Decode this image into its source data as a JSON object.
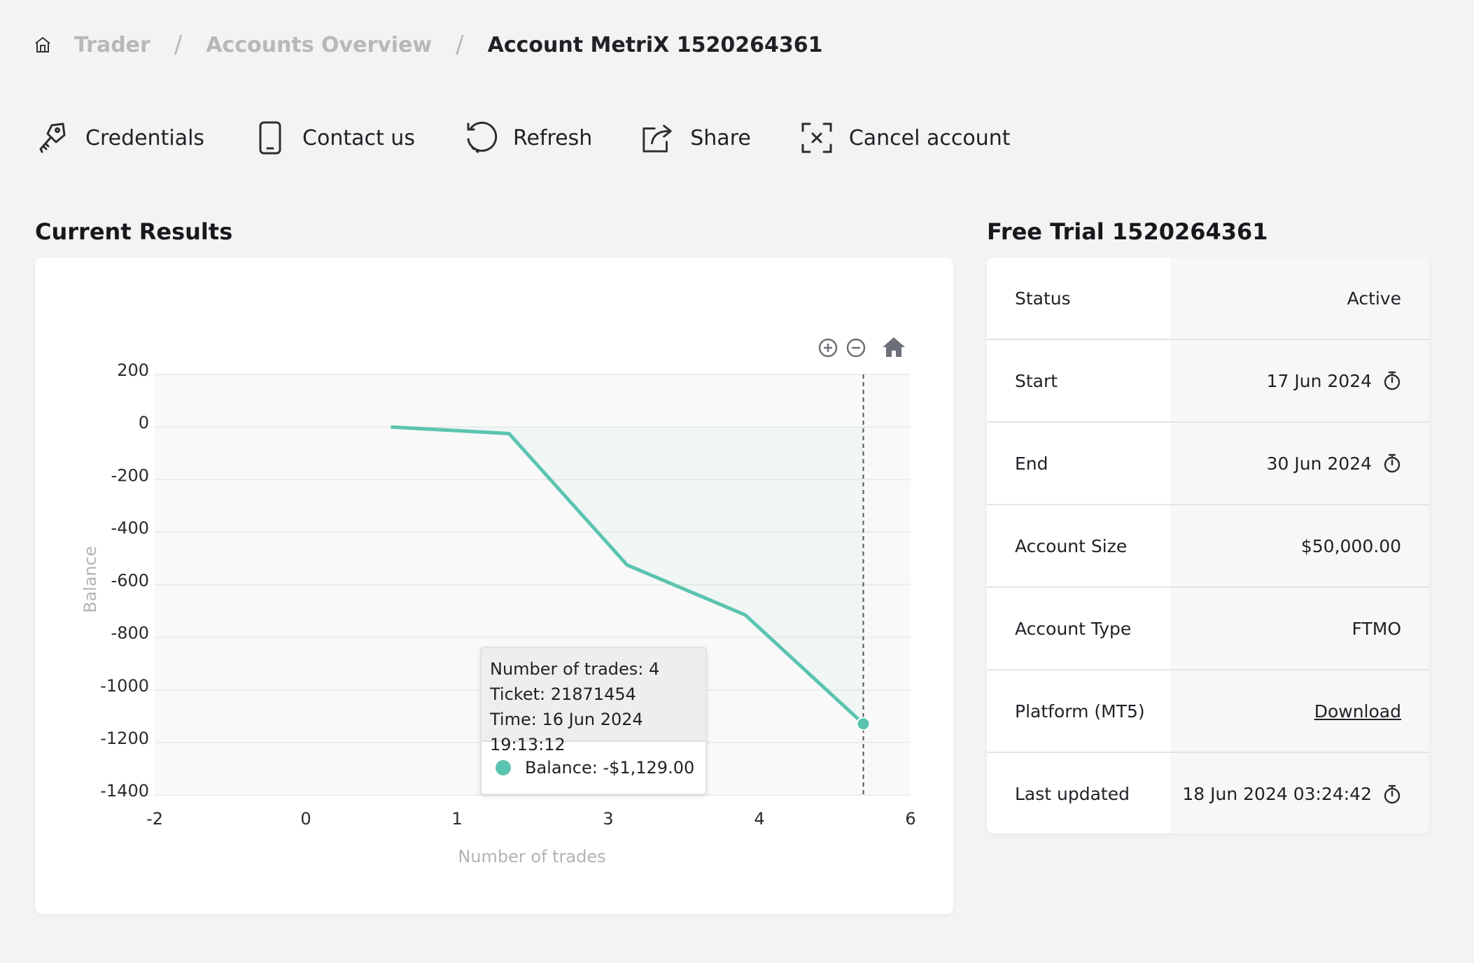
{
  "breadcrumb": {
    "items": [
      "Trader",
      "Accounts Overview"
    ],
    "separator": "/",
    "current": "Account MetriX 1520264361"
  },
  "toolbar": {
    "credentials": "Credentials",
    "contact": "Contact us",
    "refresh": "Refresh",
    "share": "Share",
    "cancel": "Cancel account"
  },
  "results": {
    "title": "Current Results"
  },
  "tooltip": {
    "trades": "Number of trades: 4",
    "ticket": "Ticket: 21871454",
    "time": "Time: 16 Jun 2024 19:13:12",
    "balance": "Balance: -$1,129.00"
  },
  "chart_data": {
    "type": "area",
    "xlabel": "Number of trades",
    "ylabel": "Balance",
    "xlim": [
      -2,
      6
    ],
    "ylim": [
      -1400,
      200
    ],
    "x_ticks": [
      "-2",
      "0",
      "1",
      "3",
      "4",
      "6"
    ],
    "y_ticks": [
      "200",
      "0",
      "-200",
      "-400",
      "-600",
      "-800",
      "-1000",
      "-1200",
      "-1400"
    ],
    "series": [
      {
        "x": [
          0.5,
          1.75,
          3.0,
          4.25,
          5.5
        ],
        "y": [
          0,
          -25,
          -525,
          -715,
          -1129
        ]
      }
    ],
    "color": "#5bc4b0",
    "crosshair_x": 5.5,
    "grid": true
  },
  "account": {
    "title": "Free Trial 1520264361",
    "rows": [
      {
        "label": "Status",
        "value": "Active"
      },
      {
        "label": "Start",
        "value": "17 Jun 2024"
      },
      {
        "label": "End",
        "value": "30 Jun 2024"
      },
      {
        "label": "Account Size",
        "value": "$50,000.00"
      },
      {
        "label": "Account Type",
        "value": "FTMO"
      },
      {
        "label": "Platform (MT5)",
        "value": "Download"
      },
      {
        "label": "Last updated",
        "value": "18 Jun 2024 03:24:42"
      }
    ]
  }
}
